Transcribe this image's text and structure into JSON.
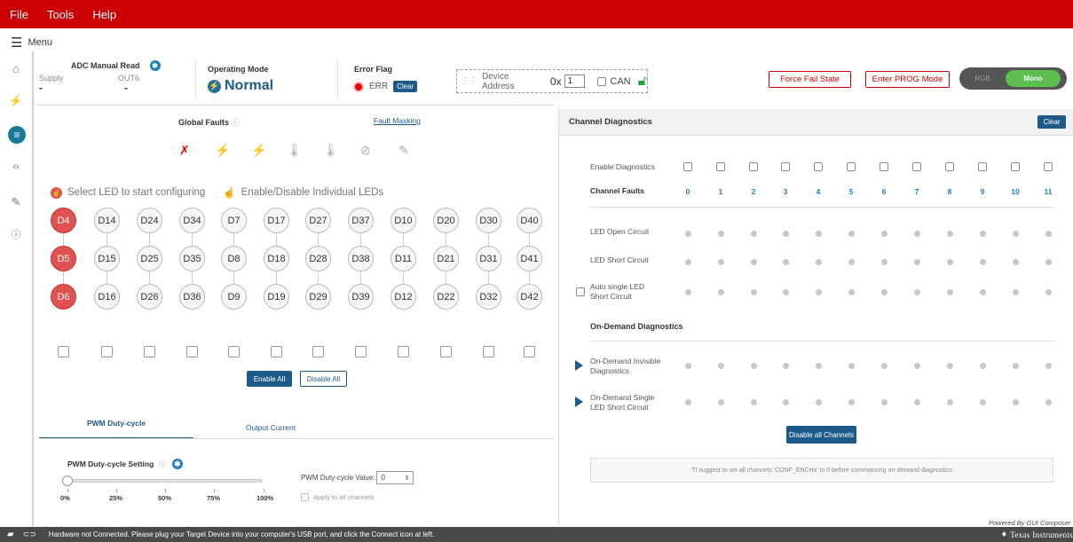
{
  "menu": {
    "file": "File",
    "tools": "Tools",
    "help": "Help",
    "menu_label": "Menu"
  },
  "header": {
    "adc_title": "ADC Manual Read",
    "supply_label": "Supply",
    "supply_value": "-",
    "out_label": "OUT6",
    "out_value": "-",
    "op_mode_title": "Operating Mode",
    "op_mode_value": "Normal",
    "err_flag_title": "Error Flag",
    "err_label": "ERR",
    "clear_label": "Clear",
    "device_addr_label": "Device Address",
    "device_addr_prefix": "0x",
    "device_addr_value": "1",
    "can_label": "CAN",
    "force_fail": "Force Fail State",
    "enter_prog": "Enter PROG Mode",
    "rgb_label": "RGB",
    "mono_label": "Mono"
  },
  "left": {
    "global_faults": "Global Faults",
    "fault_masking": "Fault Masking",
    "select_led": "Select LED to start configuring",
    "enable_disable": "Enable/Disable Individual LEDs",
    "rows": [
      [
        "D4",
        "D14",
        "D24",
        "D34",
        "D7",
        "D17",
        "D27",
        "D37",
        "D10",
        "D20",
        "D30",
        "D40"
      ],
      [
        "D5",
        "D15",
        "D25",
        "D35",
        "D8",
        "D18",
        "D28",
        "D38",
        "D11",
        "D21",
        "D31",
        "D41"
      ],
      [
        "D6",
        "D16",
        "D26",
        "D36",
        "D9",
        "D19",
        "D29",
        "D39",
        "D12",
        "D22",
        "D32",
        "D42"
      ]
    ],
    "enable_all": "Enable All",
    "disable_all": "Disable All",
    "tab_pwm": "PWM Duty-cycle",
    "tab_current": "Output Current",
    "pwm_setting": "PWM Duty-cycle Setting",
    "ticks": [
      "0%",
      "25%",
      "50%",
      "75%",
      "100%"
    ],
    "pwm_value_label": "PWM Duty-cycle Value:",
    "pwm_value": "0",
    "apply_all": "Apply to all channels"
  },
  "right": {
    "title": "Channel Diagnostics",
    "clear": "Clear",
    "enable_diag": "Enable Diagnostics",
    "channel_faults": "Channel Faults",
    "channels": [
      "0",
      "1",
      "2",
      "3",
      "4",
      "5",
      "6",
      "7",
      "8",
      "9",
      "10",
      "11"
    ],
    "led_open": "LED Open Circuit",
    "led_short": "LED Short Circuit",
    "auto_single_1": "Auto single LED",
    "auto_single_2": "Short Circuit",
    "on_demand_title": "On-Demand Diagnostics",
    "od_invisible_1": "On-Demand Invisible",
    "od_invisible_2": "Diagnostics",
    "od_single_1": "On-Demand Single",
    "od_single_2": "LED Short Circuit",
    "disable_all_channels": "Disable all Channels",
    "suggest": "TI suggest to set all channels 'CONF_ENCHx' to 0 before commencing on-demand diagnostics",
    "powered_by": "Powered By GUI Composer"
  },
  "status": {
    "message": "Hardware not Connected.   Please plug your Target Device into your computer's USB port, and click the Connect icon at left.",
    "brand": "Texas Instruments"
  }
}
